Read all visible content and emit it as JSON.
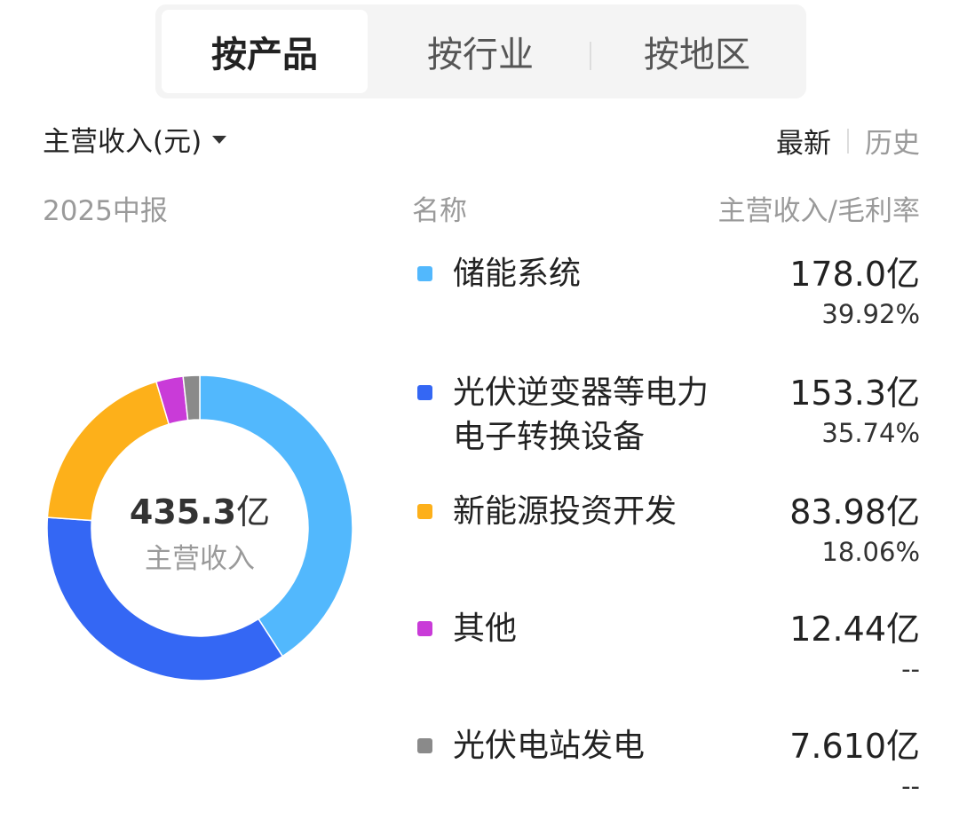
{
  "tabs": [
    {
      "label": "按产品",
      "active": true
    },
    {
      "label": "按行业",
      "active": false
    },
    {
      "label": "按地区",
      "active": false
    }
  ],
  "metric_selector": {
    "label": "主营收入(元)",
    "icon": "caret-down-icon"
  },
  "view_toggle": {
    "latest": "最新",
    "history": "历史"
  },
  "period": "2025中报",
  "table_header": {
    "name": "名称",
    "value": "主营收入/毛利率"
  },
  "center": {
    "value": "435.3",
    "unit": "亿",
    "label": "主营收入"
  },
  "colors": {
    "energy_storage": "#52b8fd",
    "pv_inverter": "#3467f4",
    "new_energy": "#fdb01a",
    "other": "#c93bd8",
    "pv_station": "#8a8a8a"
  },
  "items": [
    {
      "name": "储能系统",
      "revenue": "178.0亿",
      "margin": "39.92%"
    },
    {
      "name": "光伏逆变器等电力电子转换设备",
      "revenue": "153.3亿",
      "margin": "35.74%"
    },
    {
      "name": "新能源投资开发",
      "revenue": "83.98亿",
      "margin": "18.06%"
    },
    {
      "name": "其他",
      "revenue": "12.44亿",
      "margin": "--"
    },
    {
      "name": "光伏电站发电",
      "revenue": "7.610亿",
      "margin": "--"
    }
  ],
  "chart_data": {
    "type": "pie",
    "variant": "donut",
    "unit": "亿",
    "total": 435.3,
    "categories": [
      "储能系统",
      "光伏逆变器等电力电子转换设备",
      "新能源投资开发",
      "其他",
      "光伏电站发电"
    ],
    "values": [
      178.0,
      153.3,
      83.98,
      12.44,
      7.61
    ],
    "gross_margin": [
      "39.92%",
      "35.74%",
      "18.06%",
      "--",
      "--"
    ],
    "colors": [
      "#52b8fd",
      "#3467f4",
      "#fdb01a",
      "#c93bd8",
      "#8a8a8a"
    ],
    "start_angle": "top",
    "direction": "clockwise"
  }
}
